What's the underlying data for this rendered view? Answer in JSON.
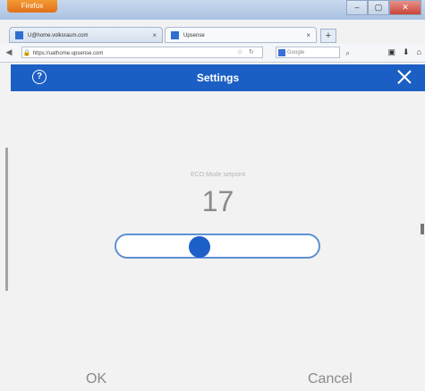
{
  "browser": {
    "app_menu_label": "Firefox",
    "tabs": [
      {
        "title": "U@home.volksraum.com"
      },
      {
        "title": "Upsense"
      }
    ],
    "url": "https://uathome.upsense.com",
    "search_placeholder": "Google",
    "window_controls": {
      "minimize": "–",
      "maximize": "▢",
      "close": "✕"
    }
  },
  "app": {
    "title": "Settings",
    "setpoint_label": "ECO Mode setpoint",
    "setpoint_value": "17",
    "slider_level_fraction": 0.4,
    "ok_label": "OK",
    "cancel_label": "Cancel"
  },
  "colors": {
    "header": "#1b5fc4",
    "slider_thumb": "#1d5fc8",
    "slider_border": "#5f8fd6",
    "background": "#f2f2f2"
  }
}
